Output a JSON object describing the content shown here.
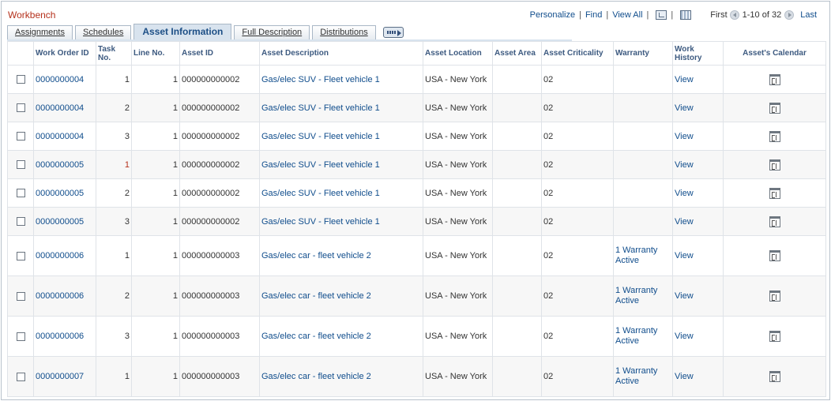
{
  "title": "Workbench",
  "nav": {
    "personalize": "Personalize",
    "find": "Find",
    "view_all": "View All",
    "sep": "|",
    "first": "First",
    "range": "1-10 of 32",
    "last": "Last"
  },
  "tabs": [
    {
      "label": "Assignments",
      "active": false
    },
    {
      "label": "Schedules",
      "active": false
    },
    {
      "label": "Asset Information",
      "active": true
    },
    {
      "label": "Full Description",
      "active": false
    },
    {
      "label": "Distributions",
      "active": false
    }
  ],
  "columns": {
    "work_order_id": "Work Order ID",
    "task_no": "Task No.",
    "line_no": "Line No.",
    "asset_id": "Asset ID",
    "asset_description": "Asset Description",
    "asset_location": "Asset Location",
    "asset_area": "Asset Area",
    "asset_criticality": "Asset Criticality",
    "warranty": "Warranty",
    "work_history": "Work History",
    "assets_calendar": "Asset's Calendar"
  },
  "rows": [
    {
      "wo": "0000000004",
      "task": "1",
      "line": "1",
      "asset_id": "000000000002",
      "desc": "Gas/elec SUV - Fleet vehicle 1",
      "loc": "USA - New York",
      "area": "",
      "crit": "02",
      "warranty": "",
      "history": "View"
    },
    {
      "wo": "0000000004",
      "task": "2",
      "line": "1",
      "asset_id": "000000000002",
      "desc": "Gas/elec SUV - Fleet vehicle 1",
      "loc": "USA - New York",
      "area": "",
      "crit": "02",
      "warranty": "",
      "history": "View"
    },
    {
      "wo": "0000000004",
      "task": "3",
      "line": "1",
      "asset_id": "000000000002",
      "desc": "Gas/elec SUV - Fleet vehicle 1",
      "loc": "USA - New York",
      "area": "",
      "crit": "02",
      "warranty": "",
      "history": "View"
    },
    {
      "wo": "0000000005",
      "task": "1",
      "line": "1",
      "asset_id": "000000000002",
      "desc": "Gas/elec SUV - Fleet vehicle 1",
      "loc": "USA - New York",
      "area": "",
      "crit": "02",
      "warranty": "",
      "history": "View"
    },
    {
      "wo": "0000000005",
      "task": "2",
      "line": "1",
      "asset_id": "000000000002",
      "desc": "Gas/elec SUV - Fleet vehicle 1",
      "loc": "USA - New York",
      "area": "",
      "crit": "02",
      "warranty": "",
      "history": "View"
    },
    {
      "wo": "0000000005",
      "task": "3",
      "line": "1",
      "asset_id": "000000000002",
      "desc": "Gas/elec SUV - Fleet vehicle 1",
      "loc": "USA - New York",
      "area": "",
      "crit": "02",
      "warranty": "",
      "history": "View"
    },
    {
      "wo": "0000000006",
      "task": "1",
      "line": "1",
      "asset_id": "000000000003",
      "desc": "Gas/elec car - fleet vehicle 2",
      "loc": "USA - New York",
      "area": "",
      "crit": "02",
      "warranty": "1 Warranty Active",
      "history": "View"
    },
    {
      "wo": "0000000006",
      "task": "2",
      "line": "1",
      "asset_id": "000000000003",
      "desc": "Gas/elec car - fleet vehicle 2",
      "loc": "USA - New York",
      "area": "",
      "crit": "02",
      "warranty": "1 Warranty Active",
      "history": "View"
    },
    {
      "wo": "0000000006",
      "task": "3",
      "line": "1",
      "asset_id": "000000000003",
      "desc": "Gas/elec car - fleet vehicle 2",
      "loc": "USA - New York",
      "area": "",
      "crit": "02",
      "warranty": "1 Warranty Active",
      "history": "View"
    },
    {
      "wo": "0000000007",
      "task": "1",
      "line": "1",
      "asset_id": "000000000003",
      "desc": "Gas/elec car - fleet vehicle 2",
      "loc": "USA - New York",
      "area": "",
      "crit": "02",
      "warranty": "1 Warranty Active",
      "history": "View"
    }
  ],
  "icons": {
    "zoom": "zoom-icon",
    "grid": "download-grid-icon",
    "prev": "previous-arrow-icon",
    "next": "next-arrow-icon",
    "more_tabs": "show-all-columns-icon",
    "calendar": "calendar-icon"
  },
  "colors": {
    "title": "#b5311c",
    "link": "#104d8c",
    "header": "#3d5a80",
    "active_tab": "#d8e3ee"
  }
}
